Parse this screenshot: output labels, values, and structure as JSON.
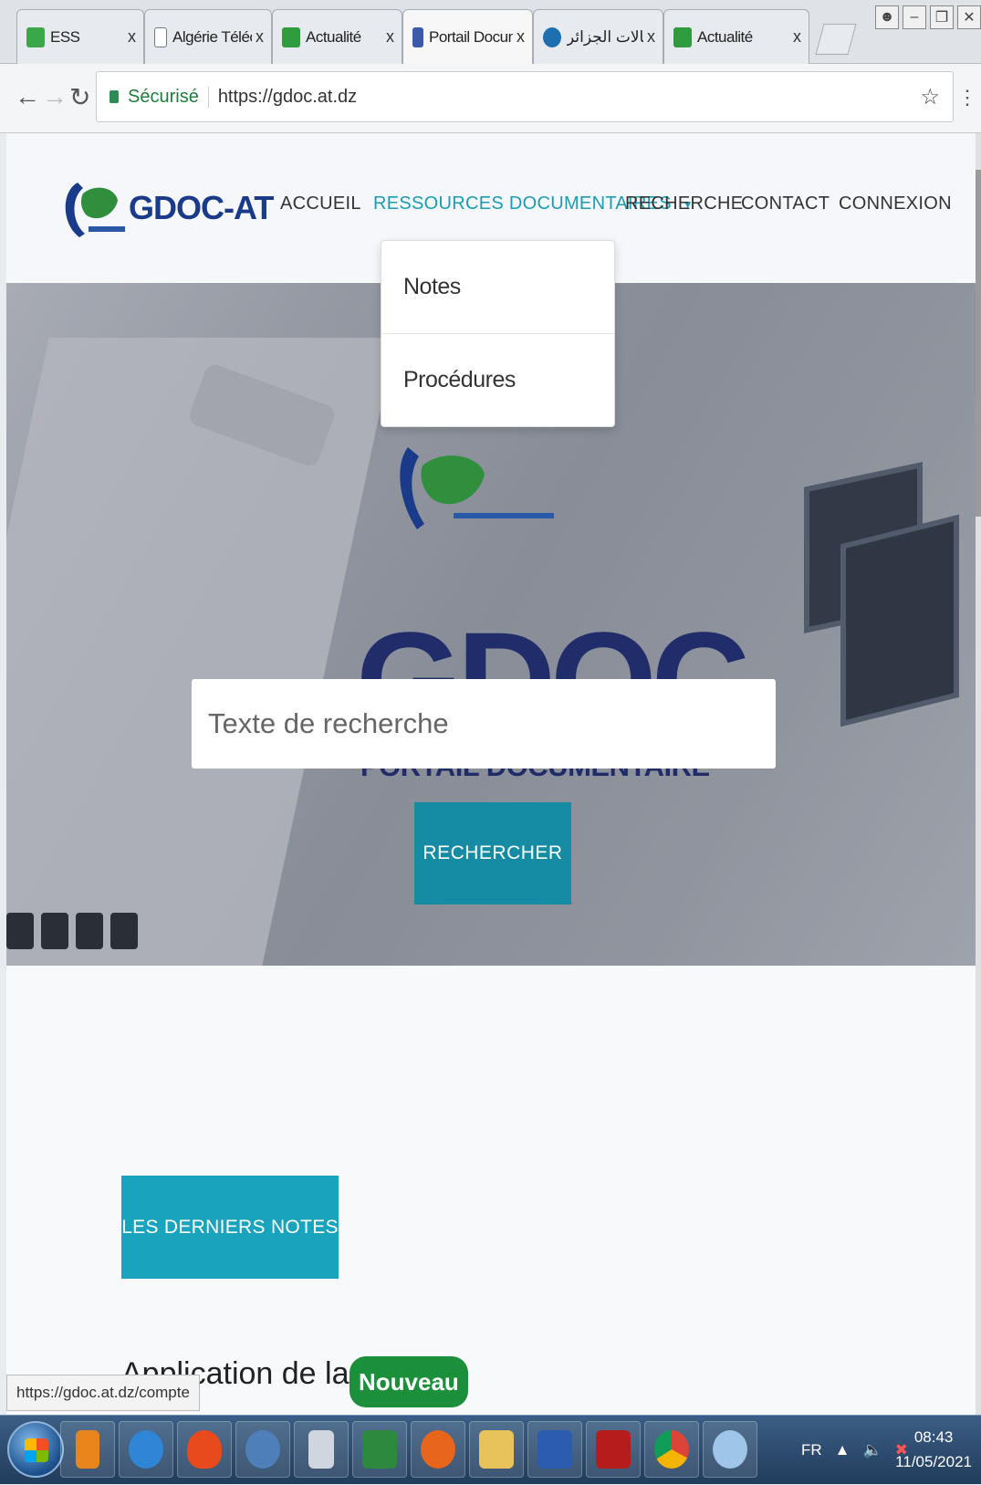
{
  "browser": {
    "tabs": [
      {
        "label": "ESS",
        "favicon_color": "#3aa84a",
        "active": false
      },
      {
        "label": "Algérie Téléco",
        "favicon_color": "#ffffff",
        "active": false
      },
      {
        "label": "Actualité",
        "favicon_color": "#2e9c3f",
        "active": false
      },
      {
        "label": "Portail Docum",
        "favicon_color": "#3b5aa8",
        "active": true
      },
      {
        "label": "اتصالات الجزائر",
        "favicon_color": "#1e6fb0",
        "active": false
      },
      {
        "label": "Actualité",
        "favicon_color": "#2e9c3f",
        "active": false
      }
    ],
    "tab_close": "x",
    "security_label": "Sécurisé",
    "url": "https://gdoc.at.dz"
  },
  "site": {
    "logo_text": "GDOC-AT",
    "nav": {
      "accueil": "ACCUEIL",
      "ressources": "RESSOURCES DOCUMENTAIRES",
      "recherche": "RECHERCHE",
      "contact": "CONTACT",
      "connexion": "CONNEXION"
    },
    "dropdown": [
      "Notes",
      "Procédures"
    ]
  },
  "hero": {
    "brand_big": "GDOC",
    "brand_sub": "PORTAIL DOCUMENTAIRE",
    "search_placeholder": "Texte de recherche",
    "search_button": "RECHERCHER"
  },
  "notes": {
    "section_button": "LES DERNIERS NOTES",
    "first_note_title": "Application de la TVA",
    "badge": "Nouveau"
  },
  "status_url": "https://gdoc.at.dz/compte",
  "taskbar": {
    "language": "FR",
    "time": "08:43",
    "date": "11/05/2021"
  },
  "colors": {
    "accent": "#1aa3bc",
    "search_button": "#168ca4",
    "brand_blue": "#1a3a8a",
    "badge_green": "#1c8f3a"
  }
}
